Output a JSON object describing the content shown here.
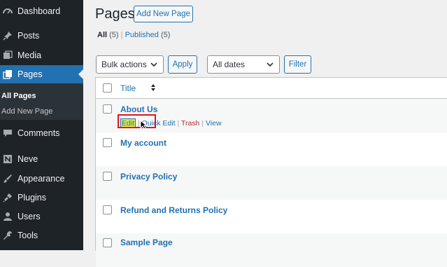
{
  "sidebar": {
    "items": [
      {
        "label": "Dashboard",
        "icon": "dashboard-icon"
      },
      {
        "label": "Posts",
        "icon": "pin-icon"
      },
      {
        "label": "Media",
        "icon": "media-icon"
      },
      {
        "label": "Pages",
        "icon": "pages-icon"
      },
      {
        "label": "Comments",
        "icon": "comment-icon"
      },
      {
        "label": "Neve",
        "icon": "neve-icon"
      },
      {
        "label": "Appearance",
        "icon": "brush-icon"
      },
      {
        "label": "Plugins",
        "icon": "plugin-icon"
      },
      {
        "label": "Users",
        "icon": "user-icon"
      },
      {
        "label": "Tools",
        "icon": "wrench-icon"
      }
    ],
    "submenu": {
      "all_pages": "All Pages",
      "add_new_page": "Add New Page"
    }
  },
  "header": {
    "title": "Pages",
    "add_new": "Add New Page"
  },
  "filters": {
    "all": "All",
    "all_count": "(5)",
    "published": "Published",
    "published_count": "(5)",
    "separator": "|"
  },
  "toolbar": {
    "bulk_actions": "Bulk actions",
    "apply": "Apply",
    "dates": "All dates",
    "filter": "Filter"
  },
  "table": {
    "column_title": "Title",
    "rows": [
      {
        "title": "About Us"
      },
      {
        "title": "My account"
      },
      {
        "title": "Privacy Policy"
      },
      {
        "title": "Refund and Returns Policy"
      },
      {
        "title": "Sample Page"
      }
    ],
    "row_actions": {
      "edit": "Edit",
      "quick_edit": "Quick Edit",
      "trash": "Trash",
      "view": "View",
      "sep": "|"
    }
  },
  "colors": {
    "accent": "#2271b1",
    "sidebar": "#1d2327",
    "highlight": "#e3151a",
    "trash": "#b32d2e"
  }
}
